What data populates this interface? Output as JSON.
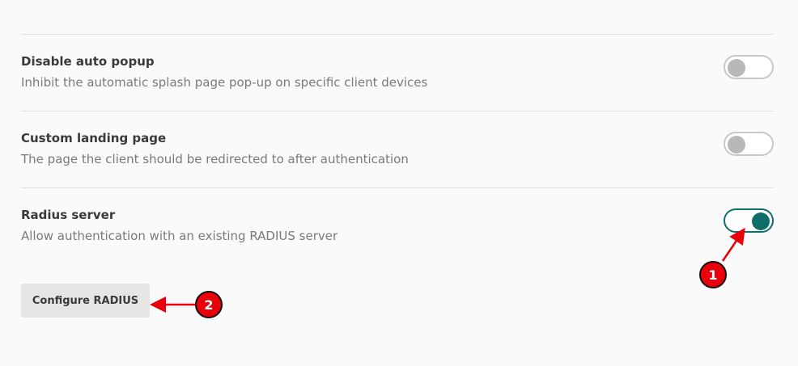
{
  "settings": [
    {
      "title": "Disable auto popup",
      "description": "Inhibit the automatic splash page pop-up on specific client devices",
      "enabled": false
    },
    {
      "title": "Custom landing page",
      "description": "The page the client should be redirected to after authentication",
      "enabled": false
    },
    {
      "title": "Radius server",
      "description": "Allow authentication with an existing RADIUS server",
      "enabled": true
    }
  ],
  "configure_button": {
    "label": "Configure RADIUS"
  },
  "annotations": {
    "marker_1": "1",
    "marker_2": "2",
    "color": "#e8000b"
  },
  "colors": {
    "accent": "#0f6e6a",
    "toggle_off": "#b8b8b8",
    "background": "#fafafa"
  }
}
